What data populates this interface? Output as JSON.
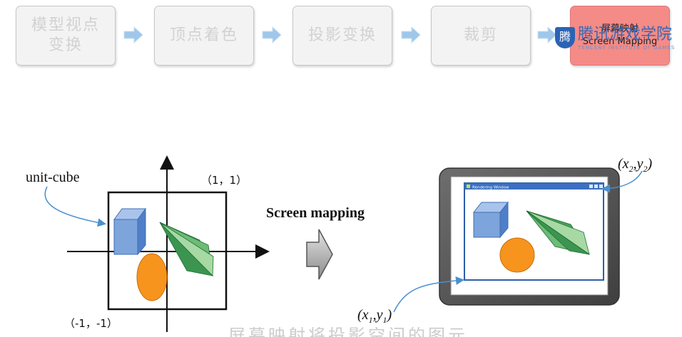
{
  "pipeline": {
    "stages": [
      {
        "line1": "模型视点",
        "line2": "变换"
      },
      {
        "line1": "顶点着色",
        "line2": ""
      },
      {
        "line1": "投影变换",
        "line2": ""
      },
      {
        "line1": "裁剪",
        "line2": ""
      },
      {
        "line1": "屏幕映射",
        "line2": "Screen Mapping"
      }
    ],
    "active_index": 4,
    "active_color": "#f58b86",
    "arrow_color": "#9fc7ea"
  },
  "watermark": {
    "badge": "腾",
    "text": "腾讯游戏学院",
    "subtext": "TENCENT INSTITUTE OF GAMES"
  },
  "diagram": {
    "unit_cube_label": "unit-cube",
    "corner_top_right": "（1，1）",
    "corner_bottom_left": "（-1，-1）",
    "arrow_label": "Screen mapping",
    "window_title": "Rendering Window",
    "point_top": {
      "x": "x",
      "xs": "2",
      "y": "y",
      "ys": "2"
    },
    "point_bottom": {
      "x": "x",
      "xs": "1",
      "y": "y",
      "ys": "1"
    },
    "colors": {
      "cube_front": "#7ea4dc",
      "cube_side": "#4f7fc8",
      "ellipse": "#f7941d",
      "cone": "#4aa05a",
      "tablet": "#5a5a5a",
      "window_frame": "#2d5fa8",
      "annot_arrow": "#4a8fd0"
    }
  },
  "caption": "屏幕映射将投影空间的图元映射到屏幕"
}
